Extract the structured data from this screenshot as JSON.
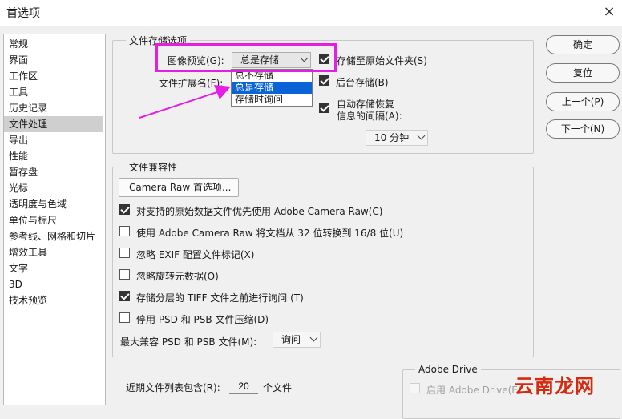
{
  "window": {
    "title": "首选项",
    "close_glyph": "×"
  },
  "sidebar": {
    "items": [
      "常规",
      "界面",
      "工作区",
      "工具",
      "历史记录",
      "文件处理",
      "导出",
      "性能",
      "暂存盘",
      "光标",
      "透明度与色域",
      "单位与标尺",
      "参考线、网格和切片",
      "增效工具",
      "文字",
      "3D",
      "技术预览"
    ],
    "selected_index": 5
  },
  "file_save": {
    "legend": "文件存储选项",
    "image_preview_label": "图像预览(G):",
    "image_preview_value": "总是存储",
    "file_ext_label": "文件扩展名(F):",
    "dropdown_options": [
      "总不存储",
      "总是存储",
      "存储时询问"
    ],
    "dropdown_highlight_index": 1,
    "save_original_folder": "存储至原始文件夹(S)",
    "background_save": "后台存储(B)",
    "autosave_line1": "自动存储恢复",
    "autosave_line2": "信息的间隔(A):",
    "autosave_interval": "10 分钟",
    "checked": {
      "save_original_folder": true,
      "background_save": true,
      "autosave": true
    }
  },
  "compat": {
    "legend": "文件兼容性",
    "camera_raw_btn": "Camera Raw 首选项...",
    "options": [
      {
        "label": "对支持的原始数据文件优先使用 Adobe Camera Raw(C)",
        "checked": true
      },
      {
        "label": "使用 Adobe Camera Raw 将文档从 32 位转换到 16/8 位(U)",
        "checked": false
      },
      {
        "label": "忽略 EXIF 配置文件标记(X)",
        "checked": false
      },
      {
        "label": "忽略旋转元数据(O)",
        "checked": false
      },
      {
        "label": "存储分层的 TIFF 文件之前进行询问 (T)",
        "checked": true
      },
      {
        "label": "停用 PSD 和 PSB 文件压缩(D)",
        "checked": false
      }
    ],
    "max_compat_label": "最大兼容 PSD 和 PSB 文件(M):",
    "max_compat_value": "询问"
  },
  "recent": {
    "label": "近期文件列表包含(R):",
    "value": "20",
    "suffix": "个文件"
  },
  "adobe_drive": {
    "legend": "Adobe Drive",
    "enable_label": "启用 Adobe Drive(E)"
  },
  "buttons": {
    "ok": "确定",
    "reset": "复位",
    "prev": "上一个(P)",
    "next": "下一个(N)"
  },
  "watermark": "云南龙网",
  "colors": {
    "highlight": "#0a64d6",
    "annotation": "#e51ee5",
    "watermark": "#d42b10"
  }
}
